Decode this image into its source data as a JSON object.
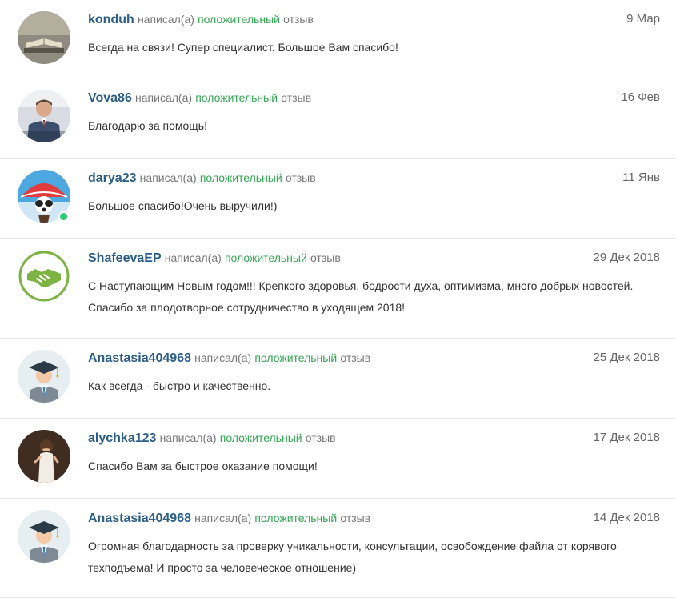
{
  "reviews": [
    {
      "username": "konduh",
      "wrote": "написал(а)",
      "rating": "положительный",
      "noun": "отзыв",
      "date": "9 Мар",
      "text": "Всегда на связи! Супер специалист. Большое Вам спасибо!"
    },
    {
      "username": "Vova86",
      "wrote": "написал(а)",
      "rating": "положительный",
      "noun": "отзыв",
      "date": "16 Фев",
      "text": "Благодарю за помощь!"
    },
    {
      "username": "darya23",
      "wrote": "написал(а)",
      "rating": "положительный",
      "noun": "отзыв",
      "date": "11 Янв",
      "text": "Большое спасибо!Очень выручили!)"
    },
    {
      "username": "ShafeevaEP",
      "wrote": "написал(а)",
      "rating": "положительный",
      "noun": "отзыв",
      "date": "29 Дек 2018",
      "text": "С Наступающим Новым годом!!! Крепкого здоровья, бодрости духа, оптимизма, много добрых новостей. Спасибо за плодотворное сотрудничество в уходящем 2018!"
    },
    {
      "username": "Anastasia404968",
      "wrote": "написал(а)",
      "rating": "положительный",
      "noun": "отзыв",
      "date": "25 Дек 2018",
      "text": "Как всегда - быстро и качественно."
    },
    {
      "username": "alychka123",
      "wrote": "написал(а)",
      "rating": "положительный",
      "noun": "отзыв",
      "date": "17 Дек 2018",
      "text": "Спасибо Вам за быстрое оказание помощи!"
    },
    {
      "username": "Anastasia404968",
      "wrote": "написал(а)",
      "rating": "положительный",
      "noun": "отзыв",
      "date": "14 Дек 2018",
      "text": "Огромная благодарность за проверку уникальности, консультации, освобождение файла от корявого техподъема! И просто за человеческое отношение)"
    }
  ],
  "colors": {
    "username": "#2b5e87",
    "positive": "#34a853",
    "online": "#2ecc71"
  }
}
